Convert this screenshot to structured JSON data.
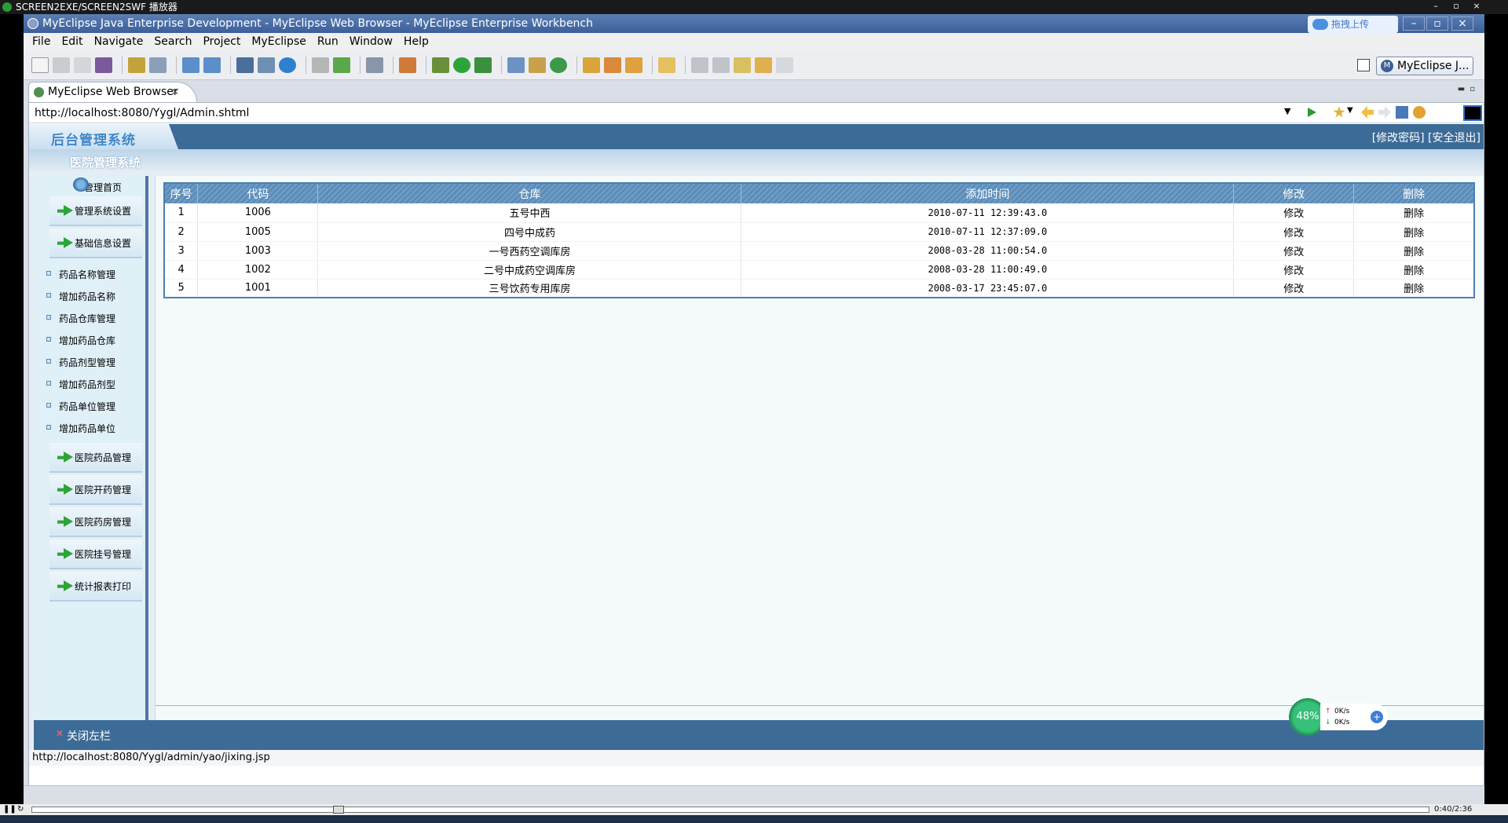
{
  "player": {
    "title": "SCREEN2EXE/SCREEN2SWF 播放器",
    "time": "0:40/2:36",
    "progress": 0.217
  },
  "window": {
    "title": "MyEclipse Java Enterprise Development - MyEclipse Web Browser - MyEclipse Enterprise Workbench",
    "upload_badge": "拖拽上传"
  },
  "menu": [
    "File",
    "Edit",
    "Navigate",
    "Search",
    "Project",
    "MyEclipse",
    "Run",
    "Window",
    "Help"
  ],
  "perspective": {
    "label": "MyEclipse J..."
  },
  "editor_tab": {
    "label": "MyEclipse Web Browser"
  },
  "browser": {
    "url": "http://localhost:8080/Yygl/Admin.shtml",
    "status_url": "http://localhost:8080/Yygl/admin/yao/jixing.jsp"
  },
  "page": {
    "logo": "后台管理系统",
    "header_links": "[修改密码] [安全退出]",
    "hospital_name": "医院管理系统",
    "sidebar": {
      "home": "管理首页",
      "sections_top": [
        "管理系统设置",
        "基础信息设置"
      ],
      "subitems": [
        "药品名称管理",
        "增加药品名称",
        "药品仓库管理",
        "增加药品仓库",
        "药品剂型管理",
        "增加药品剂型",
        "药品单位管理",
        "增加药品单位"
      ],
      "sections_bottom": [
        "医院药品管理",
        "医院开药管理",
        "医院药房管理",
        "医院挂号管理",
        "统计报表打印"
      ]
    },
    "close_sidebar": "关闭左栏",
    "table": {
      "headers": [
        "序号",
        "代码",
        "仓库",
        "添加时间",
        "修改",
        "删除"
      ],
      "rows": [
        [
          "1",
          "1006",
          "五号中西",
          "2010-07-11 12:39:43.0",
          "修改",
          "删除"
        ],
        [
          "2",
          "1005",
          "四号中成药",
          "2010-07-11 12:37:09.0",
          "修改",
          "删除"
        ],
        [
          "3",
          "1003",
          "一号西药空调库房",
          "2008-03-28 11:00:54.0",
          "修改",
          "删除"
        ],
        [
          "4",
          "1002",
          "二号中成药空调库房",
          "2008-03-28 11:00:49.0",
          "修改",
          "删除"
        ],
        [
          "5",
          "1001",
          "三号饮药专用库房",
          "2008-03-17 23:45:07.0",
          "修改",
          "删除"
        ]
      ]
    }
  },
  "net_widget": {
    "percent": "48%",
    "up": "0K/s",
    "down": "0K/s"
  },
  "colors": {
    "header_blue": "#3d6b97",
    "table_header": "#5789b5",
    "accent_green": "#2fa33a"
  }
}
